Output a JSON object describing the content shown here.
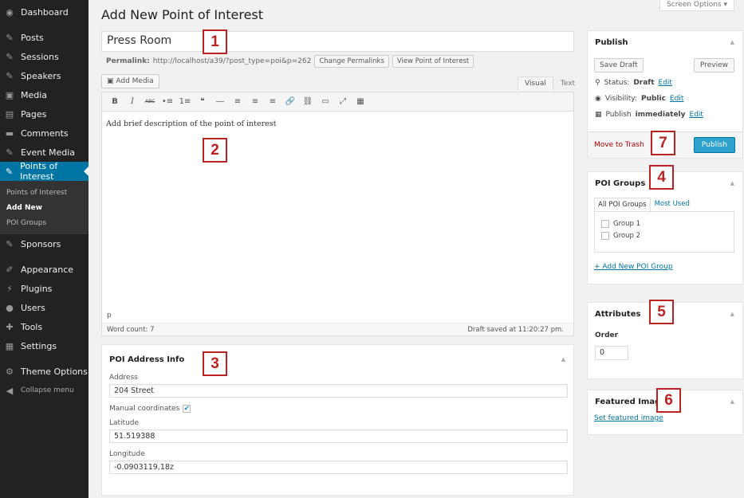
{
  "sidebar": {
    "items": [
      {
        "label": "Dashboard",
        "icon": "dashboard-icon",
        "glyph": "◉"
      },
      {
        "label": "Posts",
        "icon": "pin-icon",
        "glyph": "✎"
      },
      {
        "label": "Sessions",
        "icon": "pin-icon",
        "glyph": "✎"
      },
      {
        "label": "Speakers",
        "icon": "pin-icon",
        "glyph": "✎"
      },
      {
        "label": "Media",
        "icon": "media-icon",
        "glyph": "▣"
      },
      {
        "label": "Pages",
        "icon": "pages-icon",
        "glyph": "▤"
      },
      {
        "label": "Comments",
        "icon": "comments-icon",
        "glyph": "▬"
      },
      {
        "label": "Event Media",
        "icon": "pin-icon",
        "glyph": "✎"
      },
      {
        "label": "Points of Interest",
        "icon": "pin-icon",
        "glyph": "✎"
      },
      {
        "label": "Sponsors",
        "icon": "pin-icon",
        "glyph": "✎"
      },
      {
        "label": "Appearance",
        "icon": "appearance-icon",
        "glyph": "✐"
      },
      {
        "label": "Plugins",
        "icon": "plugins-icon",
        "glyph": "⚡"
      },
      {
        "label": "Users",
        "icon": "users-icon",
        "glyph": "●"
      },
      {
        "label": "Tools",
        "icon": "tools-icon",
        "glyph": "✚"
      },
      {
        "label": "Settings",
        "icon": "settings-icon",
        "glyph": "▦"
      },
      {
        "label": "Theme Options",
        "icon": "gear-icon",
        "glyph": "⚙"
      },
      {
        "label": "Collapse menu",
        "icon": "collapse-icon",
        "glyph": "◀"
      }
    ],
    "submenu": [
      "Points of Interest",
      "Add New",
      "POI Groups"
    ]
  },
  "header": {
    "screen_options": "Screen Options ▾",
    "title": "Add New Point of Interest"
  },
  "post": {
    "title": "Press Room",
    "permalink_label": "Permalink:",
    "permalink_url": "http://localhost/a39/?post_type=poi&p=262",
    "change_permalinks": "Change Permalinks",
    "view_poi": "View Point of Interest"
  },
  "editor": {
    "add_media": "Add Media",
    "tab_visual": "Visual",
    "tab_text": "Text",
    "toolbar": [
      "B",
      "I",
      "ABC",
      "•≡",
      "1≡",
      "❝",
      "―",
      "≡",
      "≡",
      "≡",
      "🔗",
      "⛓",
      "▭",
      "⤢",
      "▦"
    ],
    "content": "Add brief description of the point of interest",
    "path": "p",
    "word_count": "Word count: 7",
    "draft_saved": "Draft saved at 11:20:27 pm."
  },
  "poi_address": {
    "title": "POI Address Info",
    "address_label": "Address",
    "address": "204 Street",
    "manual_label": "Manual coordinates",
    "manual_checked": true,
    "lat_label": "Latitude",
    "lat": "51.519388",
    "lng_label": "Longitude",
    "lng": "-0.0903119,18z"
  },
  "publish": {
    "title": "Publish",
    "save_draft": "Save Draft",
    "preview": "Preview",
    "status_label": "Status:",
    "status": "Draft",
    "visibility_label": "Visibility:",
    "visibility": "Public",
    "publish_label": "Publish",
    "publish_when": "immediately",
    "edit": "Edit",
    "trash": "Move to Trash",
    "publish_btn": "Publish"
  },
  "groups": {
    "title": "POI Groups",
    "tab_all": "All POI Groups",
    "tab_used": "Most Used",
    "items": [
      "Group 1",
      "Group 2"
    ],
    "add_new": "+ Add New POI Group"
  },
  "attributes": {
    "title": "Attributes",
    "order_label": "Order",
    "order": "0"
  },
  "featured": {
    "title": "Featured Image",
    "set": "Set featured image"
  },
  "annotations": [
    "1",
    "2",
    "3",
    "4",
    "5",
    "6",
    "7"
  ]
}
